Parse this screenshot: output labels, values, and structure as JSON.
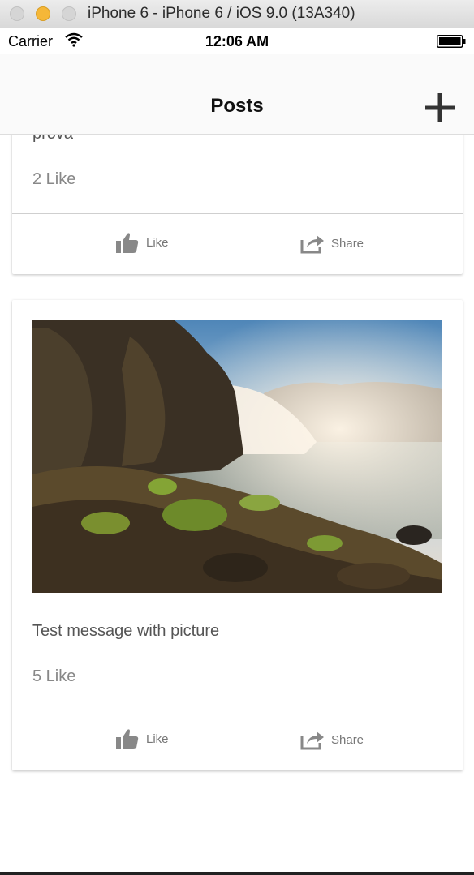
{
  "window": {
    "title": "iPhone 6 - iPhone 6 / iOS 9.0 (13A340)"
  },
  "status_bar": {
    "carrier": "Carrier",
    "time": "12:06 AM"
  },
  "nav": {
    "title": "Posts",
    "add_icon": "plus-icon"
  },
  "posts": [
    {
      "message": "prova",
      "likes": "2 Like",
      "like_label": "Like",
      "share_label": "Share"
    },
    {
      "image": "waterfall-landscape-photo",
      "message": "Test message with picture",
      "likes": "5 Like",
      "like_label": "Like",
      "share_label": "Share"
    }
  ],
  "icons": {
    "like": "thumbs-up-icon",
    "share": "share-arrow-icon"
  },
  "colors": {
    "accent": "#f5b738",
    "text": "#555555",
    "muted": "#888888"
  }
}
